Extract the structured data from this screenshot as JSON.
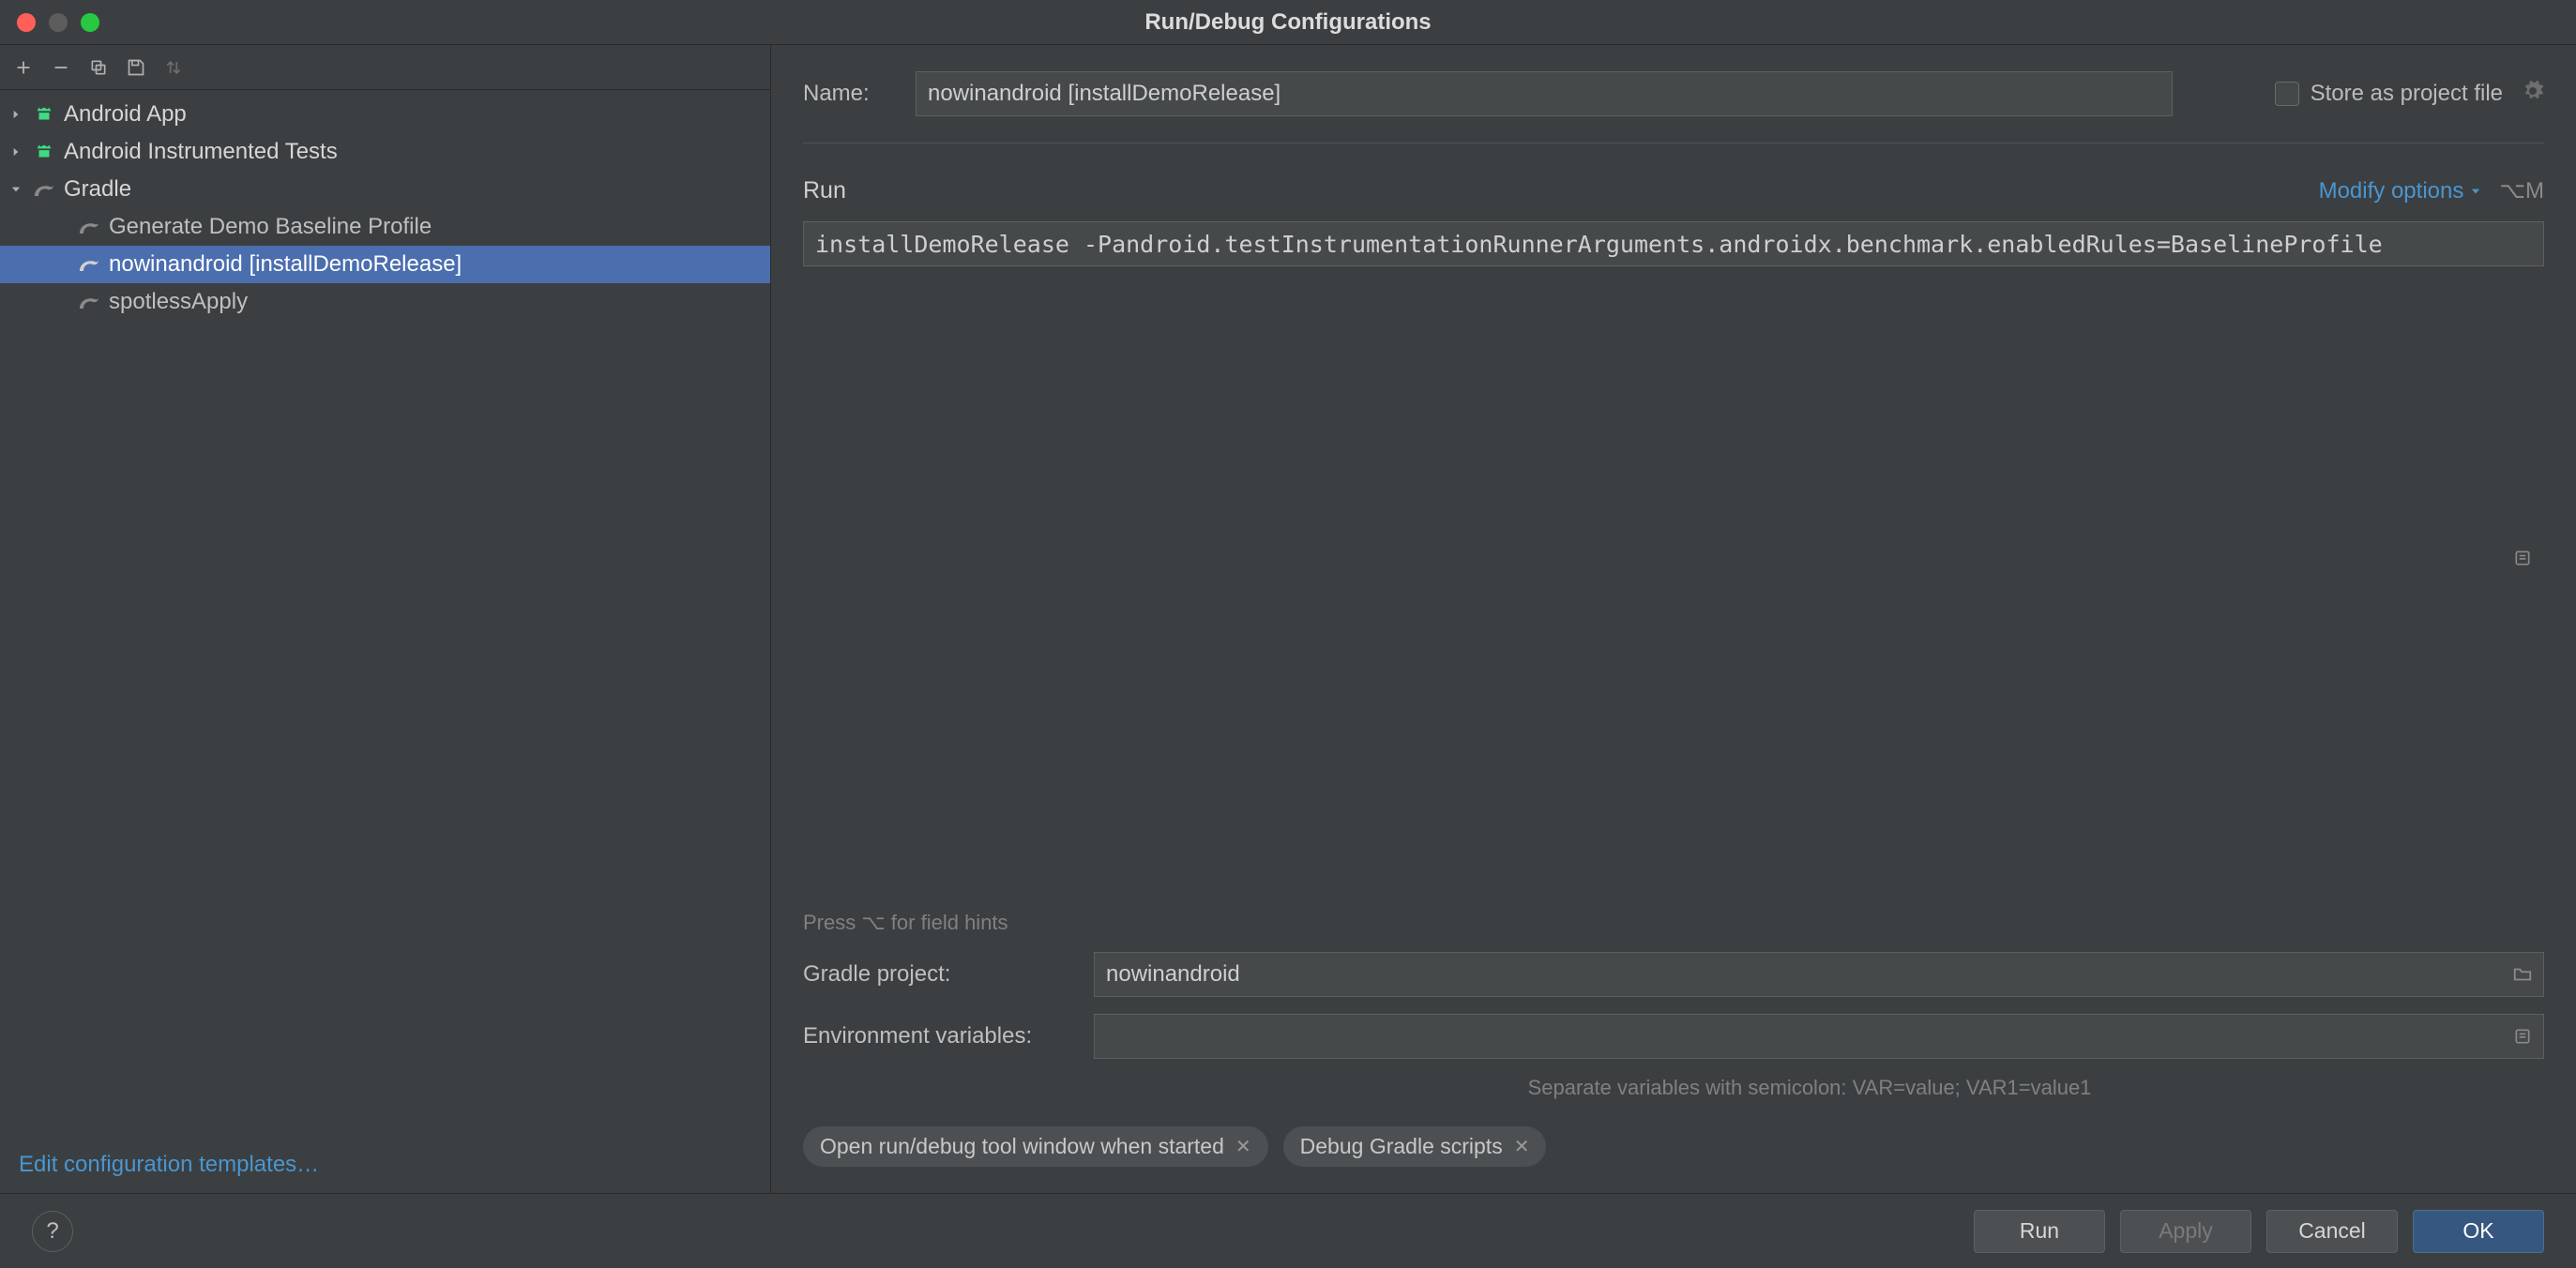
{
  "title": "Run/Debug Configurations",
  "toolbar": {
    "add": "＋",
    "remove": "－"
  },
  "tree": {
    "items": [
      {
        "label": "Android App",
        "type": "android",
        "expanded": false,
        "depth": 0
      },
      {
        "label": "Android Instrumented Tests",
        "type": "android-test",
        "expanded": false,
        "depth": 0
      },
      {
        "label": "Gradle",
        "type": "gradle",
        "expanded": true,
        "depth": 0
      },
      {
        "label": "Generate Demo Baseline Profile",
        "type": "gradle-task",
        "depth": 1,
        "selected": false
      },
      {
        "label": "nowinandroid [installDemoRelease]",
        "type": "gradle-task",
        "depth": 1,
        "selected": true
      },
      {
        "label": "spotlessApply",
        "type": "gradle-task",
        "depth": 1,
        "selected": false
      }
    ]
  },
  "edit_templates_label": "Edit configuration templates…",
  "form": {
    "name_label": "Name:",
    "name_value": "nowinandroid [installDemoRelease]",
    "store_as_project_file_label": "Store as project file",
    "run_section": "Run",
    "modify_options_label": "Modify options",
    "modify_options_shortcut": "⌥M",
    "command_value": "installDemoRelease -Pandroid.testInstrumentationRunnerArguments.androidx.benchmark.enabledRules=BaselineProfile",
    "field_hints": "Press ⌥ for field hints",
    "gradle_project_label": "Gradle project:",
    "gradle_project_value": "nowinandroid",
    "env_vars_label": "Environment variables:",
    "env_vars_value": "",
    "env_vars_hint": "Separate variables with semicolon: VAR=value; VAR1=value1",
    "chips": [
      "Open run/debug tool window when started",
      "Debug Gradle scripts"
    ]
  },
  "footer": {
    "run": "Run",
    "apply": "Apply",
    "cancel": "Cancel",
    "ok": "OK"
  }
}
